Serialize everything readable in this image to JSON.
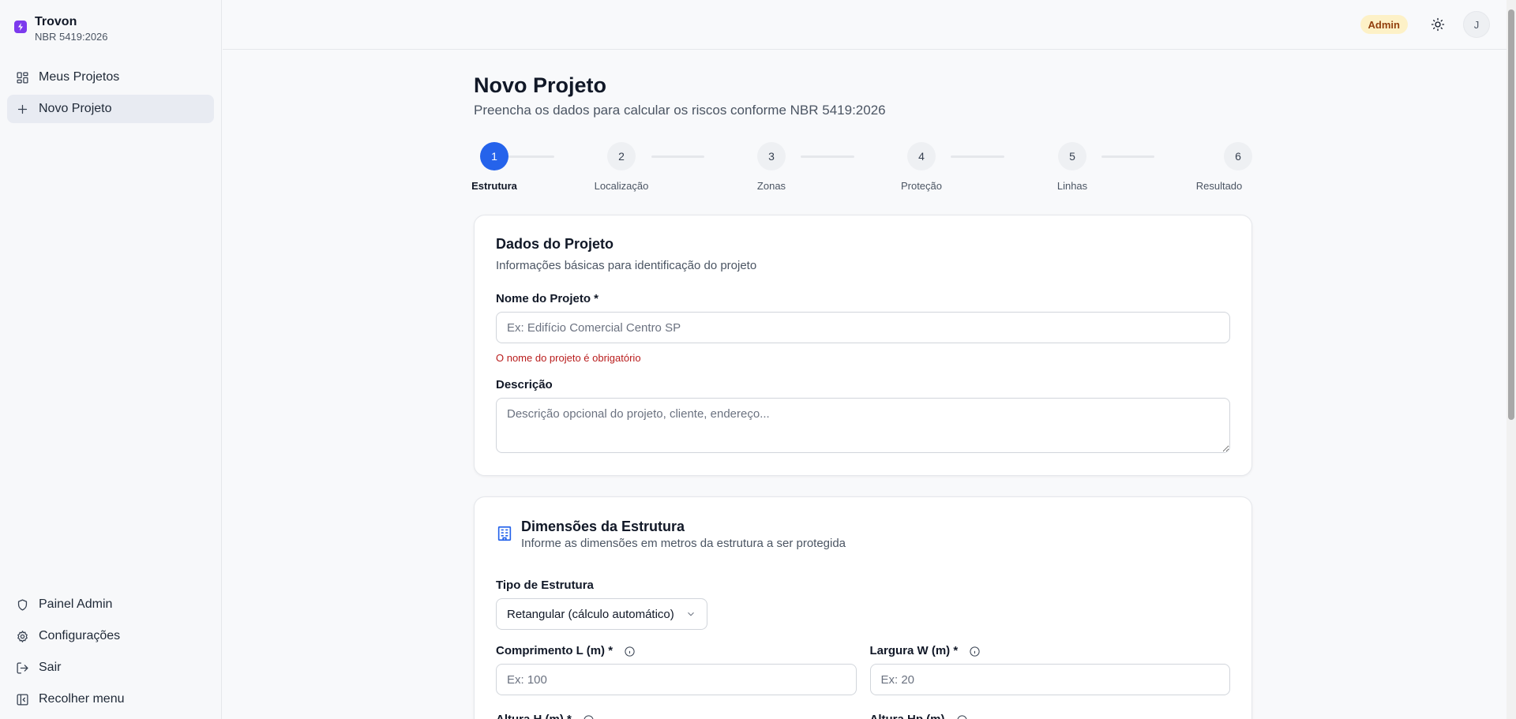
{
  "brand": {
    "title": "Trovon",
    "subtitle": "NBR 5419:2026"
  },
  "sidebar": {
    "top_items": [
      {
        "label": "Meus Projetos",
        "icon": "grid-icon"
      },
      {
        "label": "Novo Projeto",
        "icon": "plus-icon",
        "active": true
      }
    ],
    "bottom_items": [
      {
        "label": "Painel Admin",
        "icon": "shield-icon"
      },
      {
        "label": "Configurações",
        "icon": "gear-icon"
      },
      {
        "label": "Sair",
        "icon": "logout-icon"
      },
      {
        "label": "Recolher menu",
        "icon": "panel-collapse-icon"
      }
    ]
  },
  "topbar": {
    "badge": "Admin",
    "avatar_initial": "J"
  },
  "page": {
    "title": "Novo Projeto",
    "subtitle": "Preencha os dados para calcular os riscos conforme NBR 5419:2026"
  },
  "stepper": {
    "steps": [
      {
        "number": "1",
        "label": "Estrutura",
        "active": true
      },
      {
        "number": "2",
        "label": "Localização"
      },
      {
        "number": "3",
        "label": "Zonas"
      },
      {
        "number": "4",
        "label": "Proteção"
      },
      {
        "number": "5",
        "label": "Linhas"
      },
      {
        "number": "6",
        "label": "Resultado"
      }
    ]
  },
  "project_card": {
    "title": "Dados do Projeto",
    "subtitle": "Informações básicas para identificação do projeto",
    "name_label": "Nome do Projeto *",
    "name_placeholder": "Ex: Edifício Comercial Centro SP",
    "name_error": "O nome do projeto é obrigatório",
    "desc_label": "Descrição",
    "desc_placeholder": "Descrição opcional do projeto, cliente, endereço..."
  },
  "dimensions_card": {
    "title": "Dimensões da Estrutura",
    "subtitle": "Informe as dimensões em metros da estrutura a ser protegida",
    "type_label": "Tipo de Estrutura",
    "type_value": "Retangular (cálculo automático)",
    "length_label": "Comprimento L (m) *",
    "length_placeholder": "Ex: 100",
    "width_label": "Largura W (m) *",
    "width_placeholder": "Ex: 20",
    "height_label": "Altura H (m) *",
    "height_peak_label": "Altura Hp (m)"
  },
  "colors": {
    "accent": "#2563eb",
    "brand": "#7c3aed",
    "error": "#b91c1c",
    "badge_bg": "#fdf1c7"
  }
}
